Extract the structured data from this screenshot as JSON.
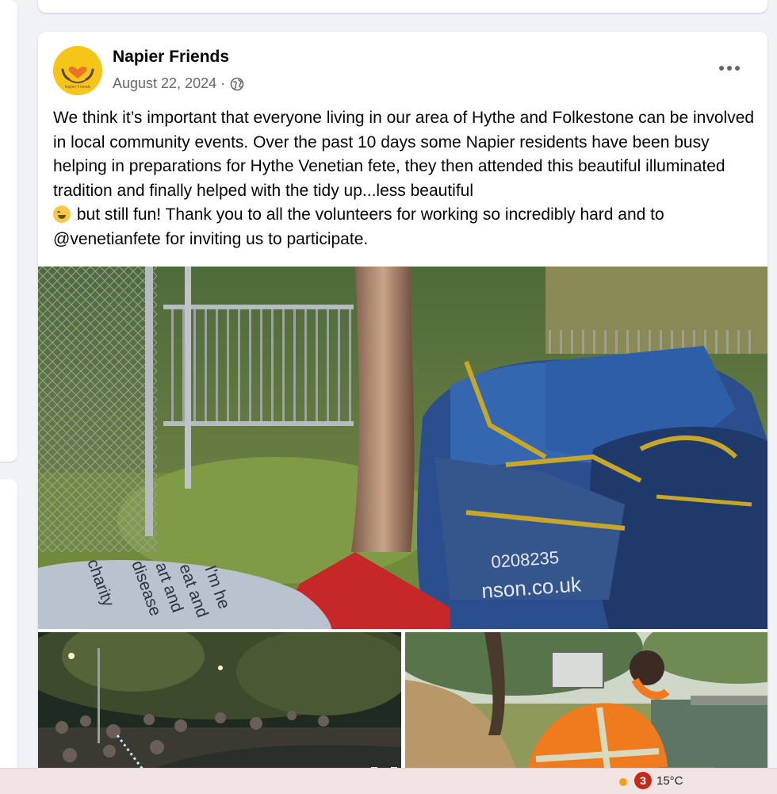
{
  "post": {
    "author": "Napier Friends",
    "avatar_caption": "Napier Friends",
    "date": "August 22, 2024 ·",
    "privacy_icon": "globe-icon",
    "more_icon": "more-options-icon",
    "text_before_emoji": "We think it’s important that everyone living in our area of Hythe and Folkestone can be involved in local community events. Over the past 10 days some Napier residents have been busy helping in preparations for Hythe Venetian fete, they then attended this beautiful illuminated tradition and finally helped with the tidy up...less beautiful\n",
    "emoji": "grinning-face-with-sweat-emoji",
    "text_after_emoji": " but still fun!  Thank you to all the volunteers for working so incredibly hard and to @venetianfete for inviting us to participate.",
    "photos": {
      "main": {
        "subject": "bulk-bags-by-tree-photo",
        "bag_text_1": "0208235",
        "bag_text_2": "nson.co.uk",
        "shirt_text": [
          "I'm he",
          "eat and",
          "art and",
          "disease",
          "charity"
        ]
      },
      "small_1": {
        "subject": "evening-fete-crowd-photo"
      },
      "small_2": {
        "subject": "volunteer-hi-vis-riverside-photo"
      }
    }
  },
  "taskbar": {
    "notification_count": "3",
    "temperature": "15°C",
    "weather_icon": "sun-icon"
  },
  "colors": {
    "page_bg": "#f0f2f5",
    "card_bg": "#ffffff",
    "secondary_text": "#65676b",
    "avatar_bg": "#f5c518",
    "badge": "#c42b1c",
    "taskbar_bg": "#f3e4e4"
  }
}
